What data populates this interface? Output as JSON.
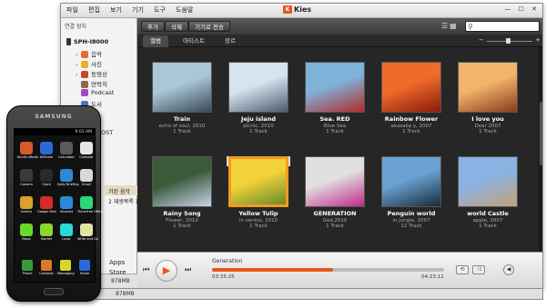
{
  "menu": [
    "파일",
    "편집",
    "보기",
    "기기",
    "도구",
    "도움말"
  ],
  "app_title": "Kies",
  "app_logo": "K",
  "window_controls": "— ☐ ✕",
  "sidebar": {
    "header": "연결 장치",
    "device": "SPH-I8000",
    "items": [
      {
        "label": "음악",
        "icon": "music-icon",
        "color": "#e86a2a"
      },
      {
        "label": "사진",
        "icon": "photo-icon",
        "color": "#e8b12a"
      },
      {
        "label": "동영상",
        "icon": "video-icon",
        "color": "#c04a2a"
      },
      {
        "label": "연락처",
        "icon": "contacts-icon",
        "color": "#8a6a4a"
      },
      {
        "label": "Podcast",
        "icon": "podcast-icon",
        "color": "#a04ac0"
      },
      {
        "label": "도서",
        "icon": "book-icon",
        "color": "#4a7ac0"
      },
      {
        "label": "",
        "icon": "folder-icon",
        "color": "#c0a04a"
      }
    ],
    "partial_1": "OST",
    "partial_2": "가된 음악",
    "partial_3": "2 재생목록 1",
    "storage": "878MB"
  },
  "toolbar": {
    "add": "추가",
    "delete": "삭제",
    "transfer": "기기로 전송",
    "search_placeholder": ""
  },
  "tabs": [
    "앨범",
    "아티스트",
    "장르"
  ],
  "albums": [
    {
      "title": "Train",
      "sub": "echo of soul, 2010",
      "tracks": "1 Track",
      "c1": "#a9c7d8",
      "c2": "#3a4a55"
    },
    {
      "title": "Jeju island",
      "sub": "picnic, 2010",
      "tracks": "1 Track",
      "c1": "#d7e3ef",
      "c2": "#4b5a70"
    },
    {
      "title": "Sea. RED",
      "sub": "Blue Sea",
      "tracks": "1 Track",
      "c1": "#7fb2d8",
      "c2": "#b02a2a"
    },
    {
      "title": "Rainbow Flower",
      "sub": "akasaka y, 2007",
      "tracks": "1 Track",
      "c1": "#f06a2a",
      "c2": "#8a1a0a"
    },
    {
      "title": "I love you",
      "sub": "Dear 2007",
      "tracks": "1 Track",
      "c1": "#f2b46a",
      "c2": "#8a3a1a"
    },
    {
      "title": "Rainy Song",
      "sub": "Flower, 2010",
      "tracks": "1 Track",
      "c1": "#3a5a3a",
      "c2": "#c8d2e8"
    },
    {
      "title": "Yellow Tulip",
      "sub": "in venice, 2010",
      "tracks": "1 Track",
      "c1": "#f2d23a",
      "c2": "#6a8a2a"
    },
    {
      "title": "GENERATION",
      "sub": "God,2010",
      "tracks": "1 Track",
      "c1": "#e0e0e0",
      "c2": "#c02a8a"
    },
    {
      "title": "Penguin world",
      "sub": "in jungle, 2007",
      "tracks": "12 Track",
      "c1": "#6aa2d2",
      "c2": "#1a2a3a"
    },
    {
      "title": "world Castle",
      "sub": "apple, 2007",
      "tracks": "1 Track",
      "c1": "#8ab2e2",
      "c2": "#c2a27a"
    }
  ],
  "player": {
    "track": "Generation",
    "elapsed": "03:35:25",
    "total": "04:23:12",
    "progress": 0.52
  },
  "phone": {
    "brand": "SAMSUNG",
    "time": "9:03 AM",
    "apps": [
      {
        "label": "Kindle eBook",
        "color": "#d85a2a"
      },
      {
        "label": "AllShare",
        "color": "#2a6ad8"
      },
      {
        "label": "Calculator",
        "color": "#5a5a5a"
      },
      {
        "label": "Calendar",
        "color": "#e6e6e6"
      },
      {
        "label": "Camera",
        "color": "#3a3a3a"
      },
      {
        "label": "Clock",
        "color": "#2a2a2a"
      },
      {
        "label": "Daily Briefing",
        "color": "#2a8ad8"
      },
      {
        "label": "Email",
        "color": "#d8d8d8"
      },
      {
        "label": "Gallery",
        "color": "#d8a22a"
      },
      {
        "label": "Google Mail",
        "color": "#d82a2a"
      },
      {
        "label": "Internet",
        "color": "#2a8ad8"
      },
      {
        "label": "ThinkFree Office",
        "color": "#2ad87a"
      },
      {
        "label": "Maps",
        "color": "#6ad82a"
      },
      {
        "label": "Market",
        "color": "#8ad82a"
      },
      {
        "label": "Layar",
        "color": "#2ad8d8"
      },
      {
        "label": "Write and Go",
        "color": "#e2e2a2"
      }
    ],
    "dock": [
      {
        "label": "Phone",
        "color": "#3a9a3a"
      },
      {
        "label": "Contacts",
        "color": "#d87a2a"
      },
      {
        "label": "Messaging",
        "color": "#d8d82a"
      },
      {
        "label": "Home",
        "color": "#2a6ad8"
      }
    ]
  },
  "float_labels": {
    "apps": "Apps",
    "store": "Store"
  }
}
